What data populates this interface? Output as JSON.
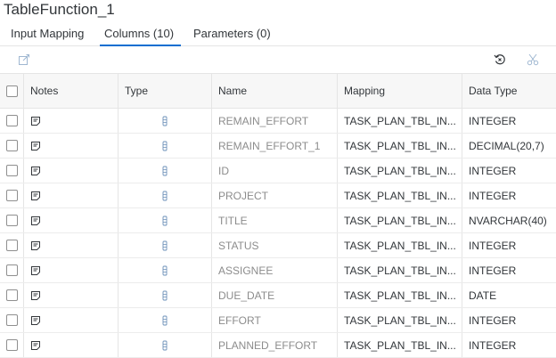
{
  "title": "TableFunction_1",
  "tabs": [
    {
      "label": "Input Mapping",
      "active": false
    },
    {
      "label": "Columns (10)",
      "active": true
    },
    {
      "label": "Parameters (0)",
      "active": false
    }
  ],
  "toolbar": {
    "icons": [
      "edit-icon",
      "restore-icon",
      "cut-icon"
    ],
    "accent_color": "#0a6ed1"
  },
  "table": {
    "headers": {
      "notes": "Notes",
      "type": "Type",
      "name": "Name",
      "mapping": "Mapping",
      "data_type": "Data Type"
    },
    "rows": [
      {
        "name": "REMAIN_EFFORT",
        "mapping": "TASK_PLAN_TBL_IN...",
        "data_type": "INTEGER"
      },
      {
        "name": "REMAIN_EFFORT_1",
        "mapping": "TASK_PLAN_TBL_IN...",
        "data_type": "DECIMAL(20,7)"
      },
      {
        "name": "ID",
        "mapping": "TASK_PLAN_TBL_IN...",
        "data_type": "INTEGER"
      },
      {
        "name": "PROJECT",
        "mapping": "TASK_PLAN_TBL_IN...",
        "data_type": "INTEGER"
      },
      {
        "name": "TITLE",
        "mapping": "TASK_PLAN_TBL_IN...",
        "data_type": "NVARCHAR(40)"
      },
      {
        "name": "STATUS",
        "mapping": "TASK_PLAN_TBL_IN...",
        "data_type": "INTEGER"
      },
      {
        "name": "ASSIGNEE",
        "mapping": "TASK_PLAN_TBL_IN...",
        "data_type": "INTEGER"
      },
      {
        "name": "DUE_DATE",
        "mapping": "TASK_PLAN_TBL_IN...",
        "data_type": "DATE"
      },
      {
        "name": "EFFORT",
        "mapping": "TASK_PLAN_TBL_IN...",
        "data_type": "INTEGER"
      },
      {
        "name": "PLANNED_EFFORT",
        "mapping": "TASK_PLAN_TBL_IN...",
        "data_type": "INTEGER"
      }
    ]
  }
}
